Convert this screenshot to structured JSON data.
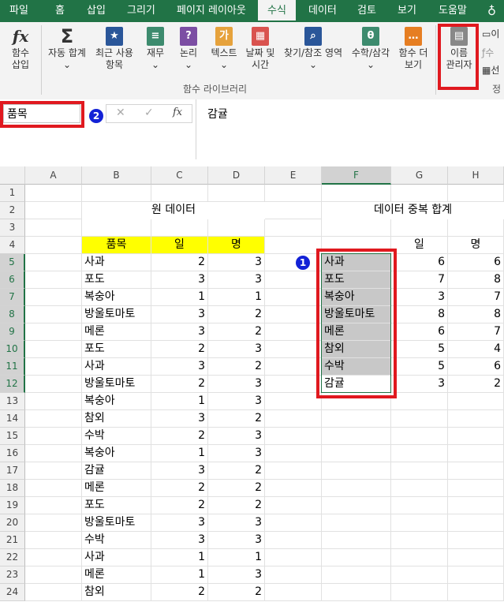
{
  "tabs": [
    "파일",
    "홈",
    "삽입",
    "그리기",
    "페이지 레이아웃",
    "수식",
    "데이터",
    "검토",
    "보기",
    "도움말"
  ],
  "active_tab": "수식",
  "ribbon": {
    "buttons": [
      {
        "label": "함수\n삽입",
        "icon": "function-icon"
      },
      {
        "label": "자동 합계",
        "icon": "sigma-icon"
      },
      {
        "label": "최근 사용\n항목",
        "icon": "star-icon"
      },
      {
        "label": "재무",
        "icon": "coins-icon"
      },
      {
        "label": "논리",
        "icon": "question-icon"
      },
      {
        "label": "텍스트",
        "icon": "text-icon"
      },
      {
        "label": "날짜 및\n시간",
        "icon": "calendar-icon"
      },
      {
        "label": "찾기/참조 영역",
        "icon": "search-icon"
      },
      {
        "label": "수학/삼각",
        "icon": "theta-icon"
      },
      {
        "label": "함수 더\n보기",
        "icon": "more-icon"
      },
      {
        "label": "이름\n관리자",
        "icon": "name-manager-icon"
      }
    ],
    "group_label": "함수 라이브러리",
    "side_items": [
      "이",
      "수",
      "선",
      "정"
    ]
  },
  "formula_bar": {
    "name_box": "품목",
    "fx_label": "fx",
    "formula": "감귤",
    "badge": "2"
  },
  "columns": [
    "A",
    "B",
    "C",
    "D",
    "E",
    "F",
    "G",
    "H"
  ],
  "rows": [
    "1",
    "2",
    "3",
    "4",
    "5",
    "6",
    "7",
    "8",
    "9",
    "10",
    "11",
    "12",
    "13",
    "14",
    "15",
    "16",
    "17",
    "18",
    "19",
    "20",
    "21",
    "22",
    "23",
    "24"
  ],
  "sheet": {
    "title_left": "원 데이터",
    "title_right": "데이터 중복 합계",
    "left_headers": [
      "품목",
      "일",
      "명"
    ],
    "left_rows": [
      [
        "사과",
        "2",
        "3"
      ],
      [
        "포도",
        "3",
        "3"
      ],
      [
        "복숭아",
        "1",
        "1"
      ],
      [
        "방울토마토",
        "3",
        "2"
      ],
      [
        "메론",
        "3",
        "2"
      ],
      [
        "포도",
        "2",
        "3"
      ],
      [
        "사과",
        "3",
        "2"
      ],
      [
        "방울토마토",
        "2",
        "3"
      ],
      [
        "복숭아",
        "1",
        "3"
      ],
      [
        "참외",
        "3",
        "2"
      ],
      [
        "수박",
        "2",
        "3"
      ],
      [
        "복숭아",
        "1",
        "3"
      ],
      [
        "감귤",
        "3",
        "2"
      ],
      [
        "메론",
        "2",
        "2"
      ],
      [
        "포도",
        "2",
        "2"
      ],
      [
        "방울토마토",
        "3",
        "3"
      ],
      [
        "수박",
        "3",
        "3"
      ],
      [
        "사과",
        "1",
        "1"
      ],
      [
        "메론",
        "1",
        "3"
      ],
      [
        "참외",
        "2",
        "2"
      ]
    ],
    "right_headers": [
      "일",
      "명"
    ],
    "right_rows": [
      [
        "사과",
        "6",
        "6"
      ],
      [
        "포도",
        "7",
        "8"
      ],
      [
        "복숭아",
        "3",
        "7"
      ],
      [
        "방울토마토",
        "8",
        "8"
      ],
      [
        "메론",
        "6",
        "7"
      ],
      [
        "참외",
        "5",
        "4"
      ],
      [
        "수박",
        "5",
        "6"
      ],
      [
        "감귤",
        "3",
        "2"
      ]
    ],
    "badge": "1"
  }
}
